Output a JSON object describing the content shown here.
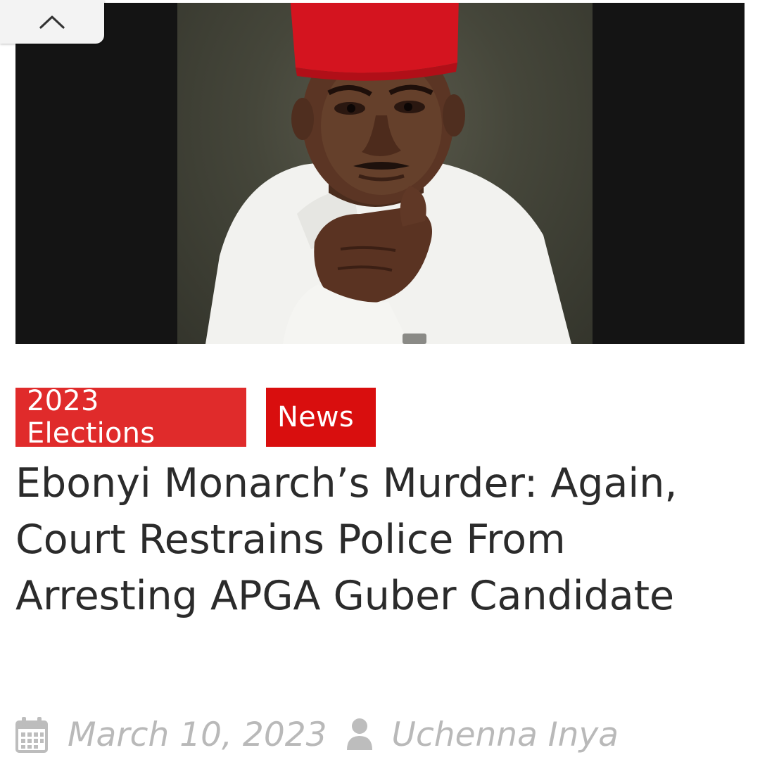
{
  "article": {
    "categories": [
      {
        "label": "2023 Elections",
        "color": "#e02b2b"
      },
      {
        "label": "News",
        "color": "#d90e0e"
      }
    ],
    "title": "Ebonyi Monarch’s Murder: Again, Court Restrains Police From Arresting APGA Guber Candidate",
    "date": "March 10, 2023",
    "author": "Uchenna Inya"
  },
  "icons": {
    "scroll_top": "chevron-up-icon",
    "date": "calendar-icon",
    "author": "user-icon"
  },
  "colors": {
    "accent": "#e02b2b",
    "title": "#2b2b2b",
    "meta": "#b9b9b9"
  }
}
